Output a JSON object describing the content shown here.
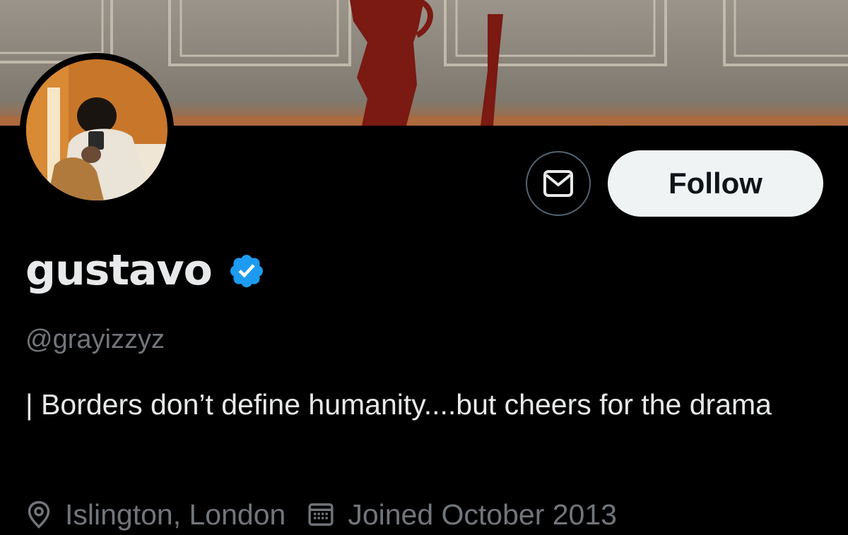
{
  "profile": {
    "display_name": "gustavo",
    "handle": "@grayizzyz",
    "bio": "| Borders don’t define humanity....but cheers for the drama",
    "location": "Islington, London",
    "joined": "Joined October 2013",
    "verified": true
  },
  "actions": {
    "follow_label": "Follow"
  },
  "icons": {
    "message": "envelope-icon",
    "verified": "verified-badge-icon",
    "location": "location-pin-icon",
    "joined": "calendar-icon"
  },
  "colors": {
    "background": "#000000",
    "verified_blue": "#1d9bf0",
    "secondary_text": "#71767b",
    "follow_button_bg": "#eff3f4"
  }
}
